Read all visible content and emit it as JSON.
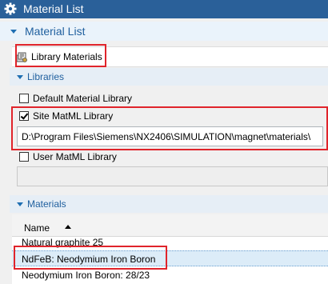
{
  "window": {
    "title": "Material List",
    "icon": "gear-icon"
  },
  "section": {
    "title": "Material List"
  },
  "library_materials": {
    "label": "Library Materials",
    "icon": "library-materials-icon"
  },
  "libraries": {
    "title": "Libraries",
    "default_label": "Default Material Library",
    "default_checked": false,
    "site_label": "Site MatML Library",
    "site_checked": true,
    "site_path": "D:\\Program Files\\Siemens\\NX2406\\SIMULATION\\magnet\\materials\\",
    "user_label": "User MatML Library",
    "user_checked": false,
    "user_path": ""
  },
  "materials": {
    "title": "Materials",
    "column_name": "Name",
    "sort": "ascending",
    "rows": [
      "Natural graphite 25",
      "NdFeB: Neodymium Iron Boron",
      "Neodymium Iron Boron: 28/23"
    ],
    "selected_row": 1
  },
  "colors": {
    "titlebar": "#2a6099",
    "accent": "#1f5f9e",
    "highlight": "#e0242b",
    "selection": "#dcecf8"
  }
}
